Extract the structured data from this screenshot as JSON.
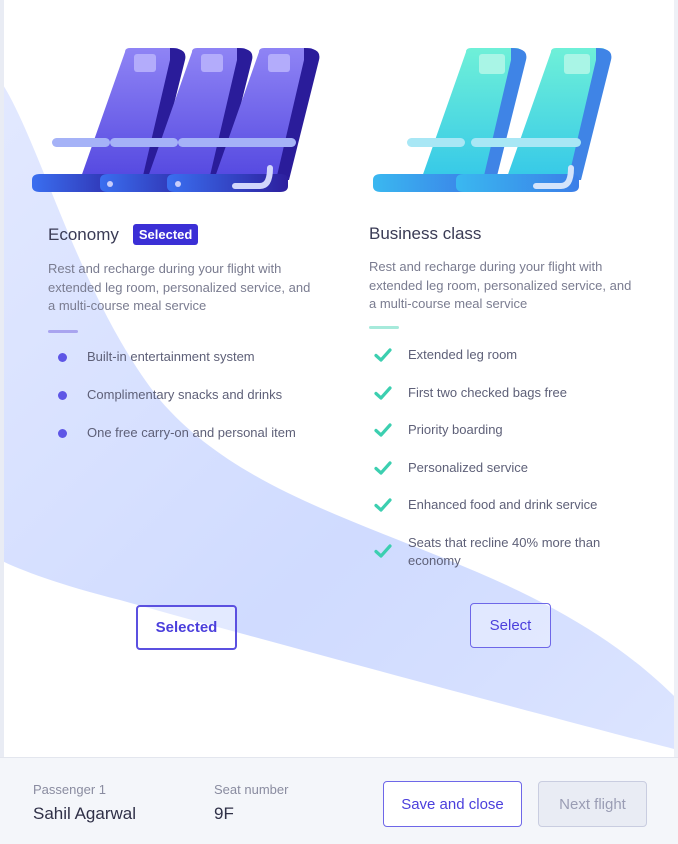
{
  "economy": {
    "title": "Economy",
    "badge": "Selected",
    "description": "Rest and recharge during your flight with extended leg room, personalized service, and a multi-course meal service",
    "features": [
      "Built-in entertainment system",
      "Complimentary snacks and drinks",
      "One free carry-on and personal item"
    ],
    "button_label": "Selected"
  },
  "business": {
    "title": "Business class",
    "description": "Rest and recharge during your flight with extended leg room, personalized service, and a multi-course meal service",
    "features": [
      "Extended leg room",
      "First two checked bags free",
      "Priority boarding",
      "Personalized service",
      "Enhanced food and drink service",
      "Seats that recline 40% more than economy"
    ],
    "button_label": "Select"
  },
  "footer": {
    "passenger_label": "Passenger 1",
    "passenger_name": "Sahil Agarwal",
    "seat_label": "Seat number",
    "seat_value": "9F",
    "save_label": "Save and close",
    "next_label": "Next flight"
  },
  "colors": {
    "accent": "#4b3fdc",
    "economy_seat": "#6b5cf0",
    "business_seat": "#4fe3d0",
    "check": "#3ccfb0",
    "bullet": "#5e56e6"
  }
}
